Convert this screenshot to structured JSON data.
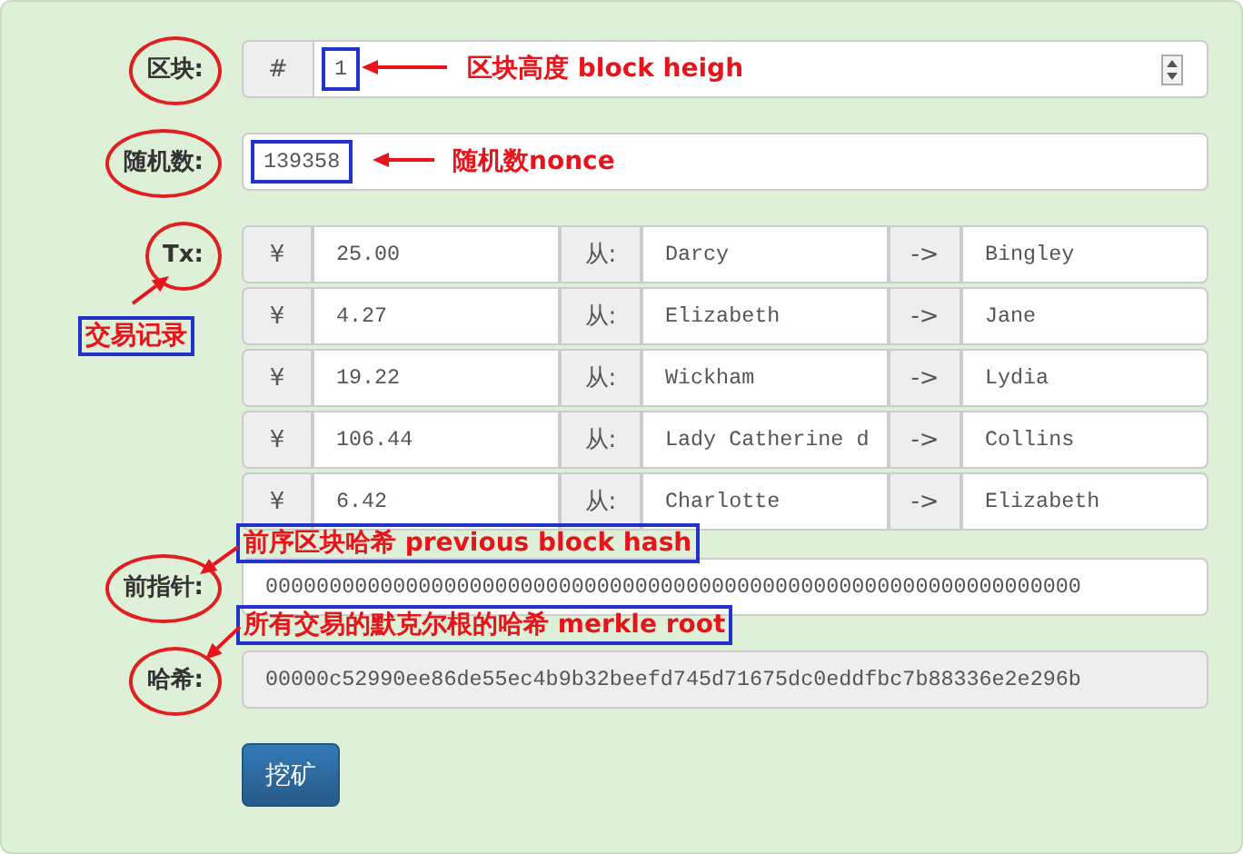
{
  "block": {
    "label": "区块:",
    "circled": true,
    "prefix": "#",
    "value": "1",
    "highlighted": true
  },
  "nonce": {
    "label": "随机数:",
    "circled": true,
    "value": "139358",
    "highlighted": true
  },
  "tx": {
    "label": "Tx:",
    "circled": true,
    "rows": [
      {
        "currency": "¥",
        "amount": "25.00",
        "from_label": "从:",
        "from": "Darcy",
        "arrow": "->",
        "to": "Bingley"
      },
      {
        "currency": "¥",
        "amount": "4.27",
        "from_label": "从:",
        "from": "Elizabeth",
        "arrow": "->",
        "to": "Jane"
      },
      {
        "currency": "¥",
        "amount": "19.22",
        "from_label": "从:",
        "from": "Wickham",
        "arrow": "->",
        "to": "Lydia"
      },
      {
        "currency": "¥",
        "amount": "106.44",
        "from_label": "从:",
        "from": "Lady Catherine d",
        "arrow": "->",
        "to": "Collins"
      },
      {
        "currency": "¥",
        "amount": "6.42",
        "from_label": "从:",
        "from": "Charlotte",
        "arrow": "->",
        "to": "Elizabeth"
      }
    ]
  },
  "previous": {
    "label": "前指针:",
    "circled": true,
    "value": "0000000000000000000000000000000000000000000000000000000000000000",
    "disabled": false
  },
  "hash": {
    "label": "哈希:",
    "circled": true,
    "value": "00000c52990ee86de55ec4b9b32beefd745d71675dc0eddfbc7b88336e2e296b",
    "disabled": true
  },
  "mine_button": "挖矿",
  "annotations": [
    {
      "text": "区块高度 block heigh",
      "boxed": false
    },
    {
      "text": "随机数nonce",
      "boxed": false
    },
    {
      "text": "交易记录",
      "boxed": true
    },
    {
      "text": "前序区块哈希 previous block hash",
      "boxed": true
    },
    {
      "text": "所有交易的默克尔根的哈希 merkle root",
      "boxed": true
    }
  ]
}
